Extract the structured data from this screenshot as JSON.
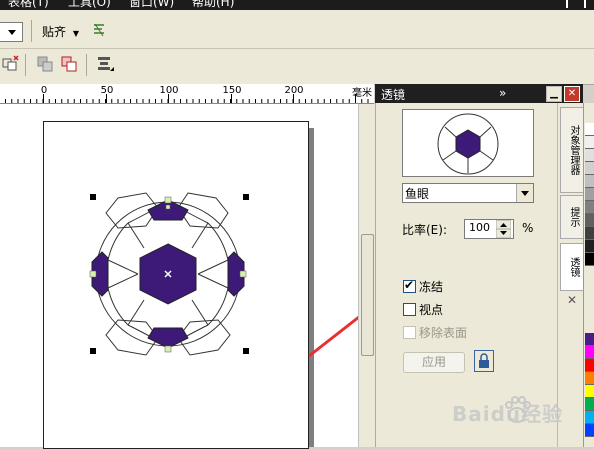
{
  "menubar": {
    "items": [
      "表格(T)",
      "工具(O)",
      "窗口(W)",
      "帮助(H)"
    ]
  },
  "toolbar": {
    "snap_label": "贴齐"
  },
  "ruler": {
    "ticks": [
      "0",
      "50",
      "100",
      "150",
      "200"
    ],
    "units": "毫米"
  },
  "docker": {
    "title": "透镜",
    "lens_type": "鱼眼",
    "rate_label": "比率(E):",
    "rate_value": "100",
    "rate_unit": "%",
    "freeze_label": "冻结",
    "freeze_checked": true,
    "viewpoint_label": "视点",
    "viewpoint_checked": false,
    "remove_face_label": "移除表面",
    "apply_label": "应用"
  },
  "side_tabs": {
    "object_manager": "对象管理器",
    "hints": "提示",
    "lens": "透镜"
  },
  "watermark": {
    "text": "Baidu经验"
  },
  "colors": {
    "ball_fill": "#3d1a78",
    "selection_handle": "#000000",
    "arrow": "#e8312f",
    "accent": "#1c5180"
  },
  "icons": [
    "close-icon",
    "minimize-icon",
    "chevron-double-right-icon",
    "lock-icon",
    "arrow-icon"
  ]
}
